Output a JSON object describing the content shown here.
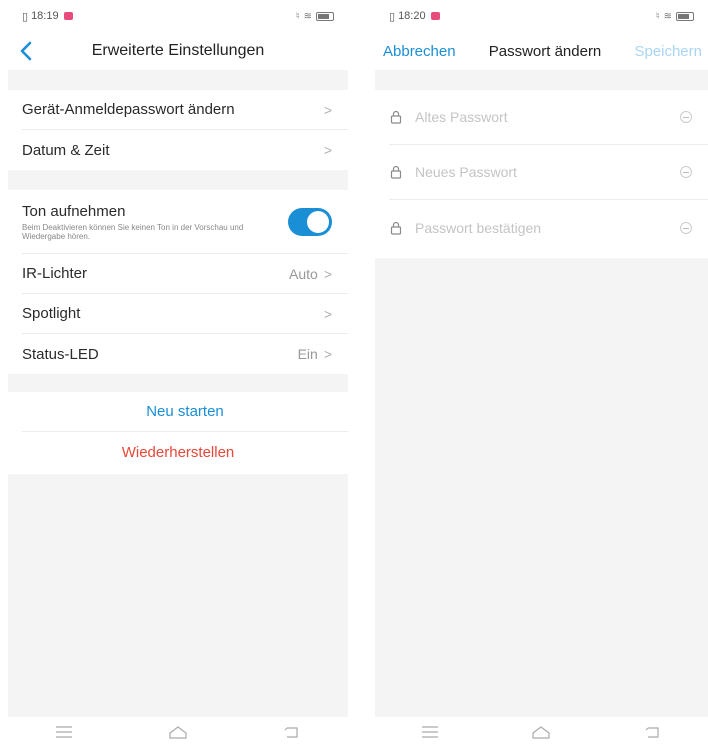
{
  "left_screen": {
    "status": {
      "time": "18:19"
    },
    "title": "Erweiterte Einstellungen",
    "group1": [
      {
        "label": "Gerät-Anmeldepasswort ändern",
        "value": ""
      },
      {
        "label": "Datum & Zeit",
        "value": ""
      }
    ],
    "record_audio": {
      "label": "Ton aufnehmen",
      "description": "Beim Deaktivieren können Sie keinen Ton in der Vorschau und Wiedergabe hören.",
      "enabled": true
    },
    "group2": [
      {
        "label": "IR-Lichter",
        "value": "Auto"
      },
      {
        "label": "Spotlight",
        "value": ""
      },
      {
        "label": "Status-LED",
        "value": "Ein"
      }
    ],
    "restart_label": "Neu starten",
    "reset_label": "Wiederherstellen"
  },
  "right_screen": {
    "status": {
      "time": "18:20"
    },
    "cancel_label": "Abbrechen",
    "title": "Passwort ändern",
    "save_label": "Speichern",
    "fields": {
      "old": {
        "placeholder": "Altes Passwort"
      },
      "new": {
        "placeholder": "Neues Passwort"
      },
      "confirm": {
        "placeholder": "Passwort bestätigen"
      }
    }
  },
  "colors": {
    "accent": "#1a8fd6",
    "danger": "#e8473a",
    "background_gray": "#f4f4f4"
  },
  "icons": [
    "back-chevron-icon",
    "chevron-right-icon",
    "lock-icon",
    "eye-hidden-icon",
    "menu-icon",
    "home-icon",
    "back-icon",
    "wifi-icon",
    "battery-icon",
    "sim-icon"
  ]
}
